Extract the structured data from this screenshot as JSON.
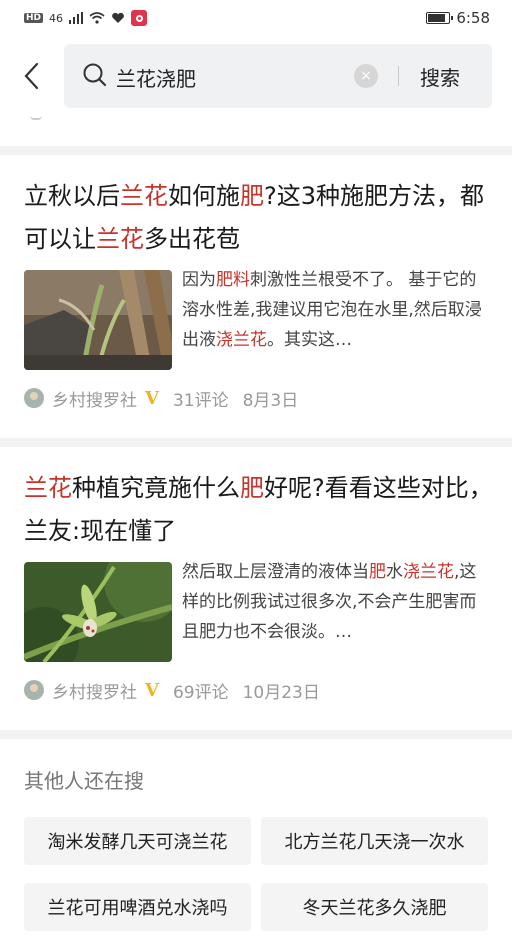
{
  "status_bar": {
    "network": "HD",
    "signal": "46",
    "time": "6:58"
  },
  "search": {
    "query": "兰花浇肥",
    "button_label": "搜索",
    "clear_glyph": "×"
  },
  "colors": {
    "highlight": "#c8342a",
    "accent_v": "#f0b323"
  },
  "articles": [
    {
      "title": [
        {
          "t": "立秋以后",
          "h": false
        },
        {
          "t": "兰花",
          "h": true
        },
        {
          "t": "如何施",
          "h": false
        },
        {
          "t": "肥",
          "h": true
        },
        {
          "t": "?这3种施肥方法，都可以让",
          "h": false
        },
        {
          "t": "兰花",
          "h": true
        },
        {
          "t": "多出花苞",
          "h": false
        }
      ],
      "snippet": [
        {
          "t": "因为",
          "h": false
        },
        {
          "t": "肥料",
          "h": true
        },
        {
          "t": "刺激性兰根受不了。 基于它的溶水性差,我建议用它泡在水里,然后取浸出液",
          "h": false
        },
        {
          "t": "浇兰花",
          "h": true
        },
        {
          "t": "。其实这…",
          "h": false
        }
      ],
      "source": "乡村搜罗社",
      "verified": "V",
      "comments": "31评论",
      "date": "8月3日"
    },
    {
      "title": [
        {
          "t": "兰花",
          "h": true
        },
        {
          "t": "种植究竟施什么",
          "h": false
        },
        {
          "t": "肥",
          "h": true
        },
        {
          "t": "好呢?看看这些对比，兰友:现在懂了",
          "h": false
        }
      ],
      "snippet": [
        {
          "t": "然后取上层澄清的液体当",
          "h": false
        },
        {
          "t": "肥",
          "h": true
        },
        {
          "t": "水",
          "h": false
        },
        {
          "t": "浇兰花",
          "h": true
        },
        {
          "t": ",这样的比例我试过很多次,不会产生肥害而且肥力也不会很淡。…",
          "h": false
        }
      ],
      "source": "乡村搜罗社",
      "verified": "V",
      "comments": "69评论",
      "date": "10月23日"
    }
  ],
  "others": {
    "title": "其他人还在搜",
    "items": [
      "淘米发酵几天可浇兰花",
      "北方兰花几天浇一次水",
      "兰花可用啤酒兑水浇吗",
      "冬天兰花多久浇肥"
    ]
  }
}
